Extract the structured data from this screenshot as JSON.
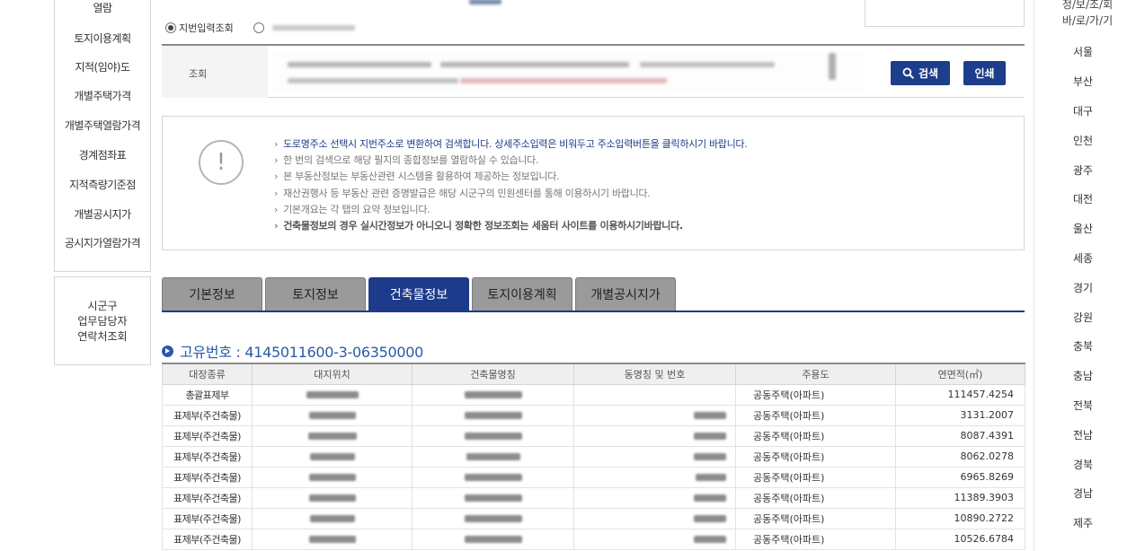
{
  "left_menu": {
    "items": [
      "열람",
      "토지이용계획",
      "지적(임야)도",
      "개별주택가격",
      "개별주택열람가격",
      "경계점좌표",
      "지적측량기준점",
      "개별공시지가",
      "공시지가열람가격"
    ]
  },
  "contact": {
    "lines": [
      "시군구",
      "업무담당자",
      "연락처조회"
    ]
  },
  "search": {
    "radio_selected": "지번입력조회",
    "field_label": "조회",
    "search_button": "검색",
    "print_button": "인쇄",
    "icons": {
      "search_button": "search-icon",
      "notice": "exclamation-icon",
      "title_bullet": "arrow-bullet-icon"
    }
  },
  "notice": {
    "lines": [
      "도로명주소 선택시 지번주소로 변환하여 검색합니다. 상세주소입력은 비워두고 주소입력버튼을 클릭하시기 바랍니다.",
      "한 번의 검색으로 해당 필지의 종합정보를 열람하실 수 있습니다.",
      "본 부동산정보는 부동산관련 시스템을 활용하여 제공하는 정보입니다.",
      "재산권행사 등 부동산 관련 증명발급은 해당 시군구의 민원센터를 통해 이용하시기 바랍니다.",
      "기본개요는 각 탭의 요약 정보입니다.",
      "건축물정보의 경우 실시간정보가 아니오니 정확한 정보조회는 세움터 사이트를 이용하시기바랍니다."
    ]
  },
  "tabs": [
    {
      "label": "기본정보",
      "active": false
    },
    {
      "label": "토지정보",
      "active": false
    },
    {
      "label": "건축물정보",
      "active": true
    },
    {
      "label": "토지이용계획",
      "active": false
    },
    {
      "label": "개별공시지가",
      "active": false
    }
  ],
  "unique_number": {
    "label": "고유번호 : 4145011600-3-06350000"
  },
  "table": {
    "headers": [
      "대장종류",
      "대지위치",
      "건축물명칭",
      "동명칭 및 번호",
      "주용도",
      "연면적(㎡)"
    ],
    "rows": [
      {
        "type": "총괄표제부",
        "use": "공동주택(아파트)",
        "area": "111457.4254"
      },
      {
        "type": "표제부(주건축물)",
        "use": "공동주택(아파트)",
        "area": "3131.2007"
      },
      {
        "type": "표제부(주건축물)",
        "use": "공동주택(아파트)",
        "area": "8087.4391"
      },
      {
        "type": "표제부(주건축물)",
        "use": "공동주택(아파트)",
        "area": "8062.0278"
      },
      {
        "type": "표제부(주건축물)",
        "use": "공동주택(아파트)",
        "area": "6965.8269"
      },
      {
        "type": "표제부(주건축물)",
        "use": "공동주택(아파트)",
        "area": "11389.3903"
      },
      {
        "type": "표제부(주건축물)",
        "use": "공동주택(아파트)",
        "area": "10890.2722"
      },
      {
        "type": "표제부(주건축물)",
        "use": "공동주택(아파트)",
        "area": "10526.6784"
      }
    ]
  },
  "right_nav": {
    "title_lines": [
      "정/보/조/회",
      "바/로/가/기"
    ],
    "cities": [
      "서울",
      "부산",
      "대구",
      "인천",
      "광주",
      "대전",
      "울산",
      "세종",
      "경기",
      "강원",
      "충북",
      "충남",
      "전북",
      "전남",
      "경북",
      "경남",
      "제주"
    ]
  },
  "colors": {
    "primary": "#1e3a8a",
    "button": "#1d3e8a",
    "title_blue": "#2a5aa8",
    "tab_inactive": "#9a9a9a"
  }
}
